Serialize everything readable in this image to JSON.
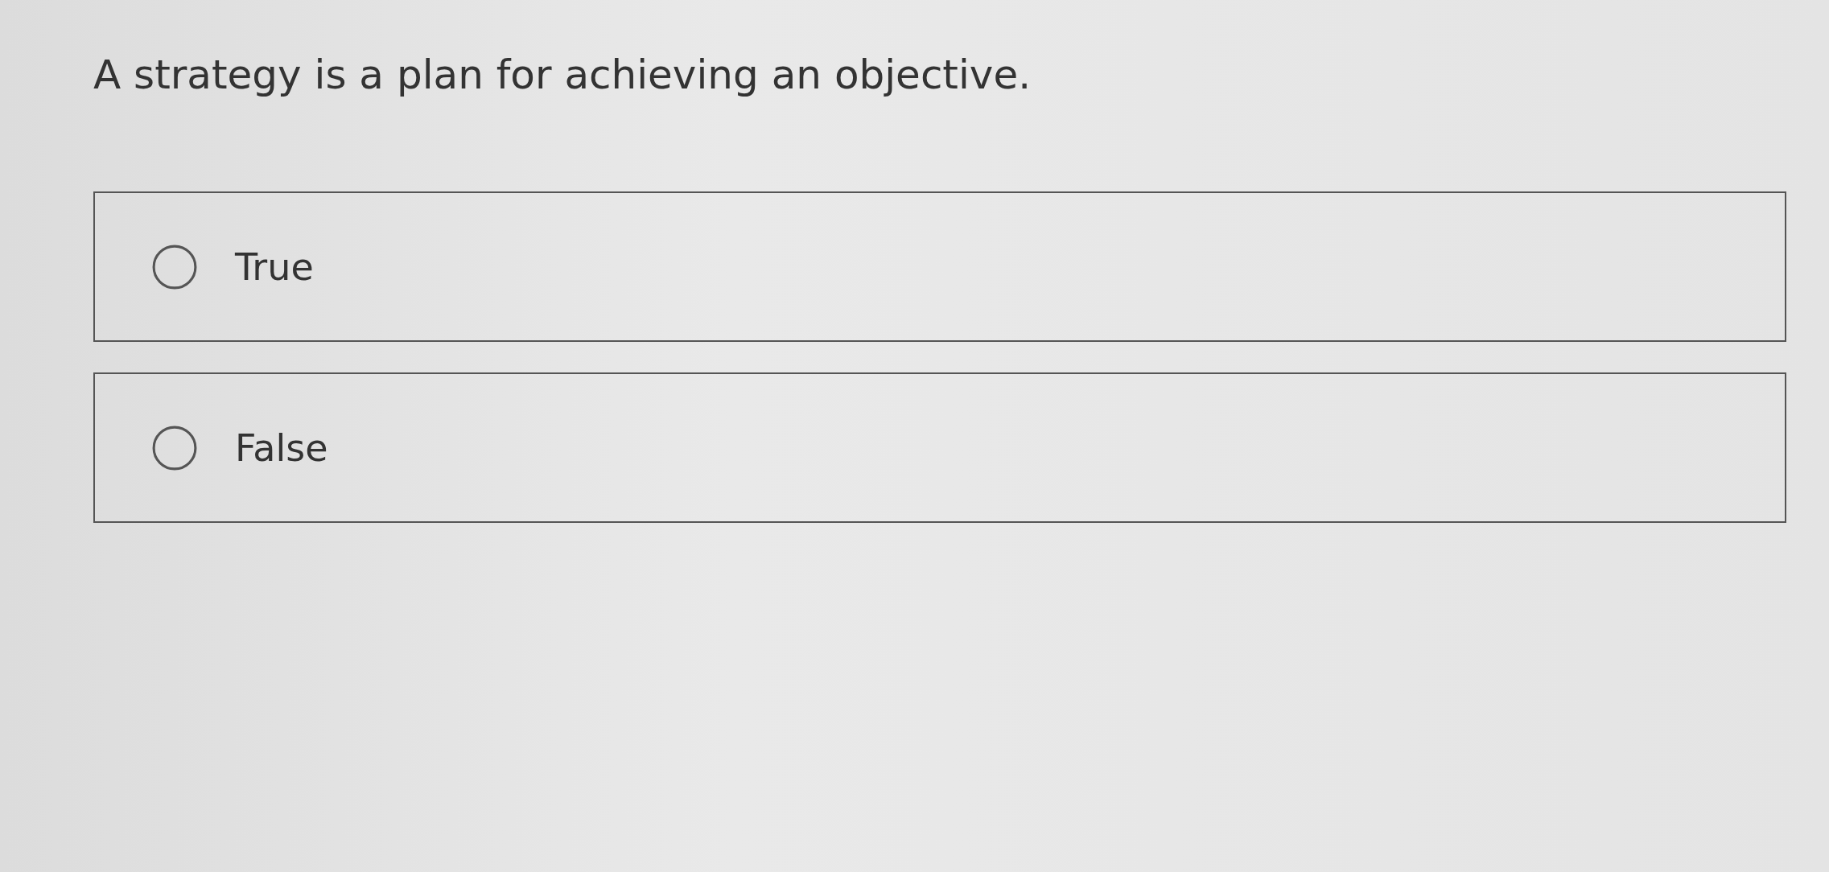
{
  "question": "A strategy is a plan for achieving an objective.",
  "options": [
    {
      "label": "True",
      "selected": false
    },
    {
      "label": "False",
      "selected": false
    }
  ]
}
